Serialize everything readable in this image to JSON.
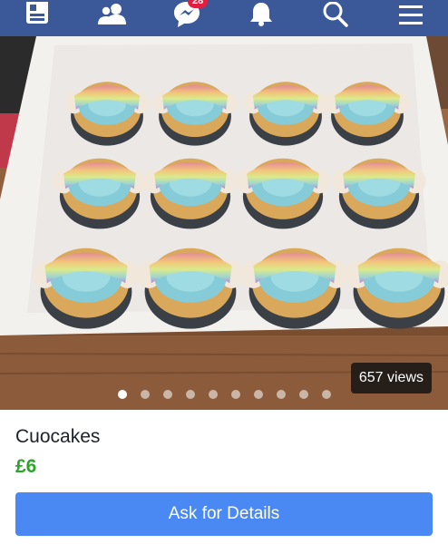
{
  "nav": {
    "items": [
      {
        "name": "feed-icon"
      },
      {
        "name": "friends-icon"
      },
      {
        "name": "messenger-icon"
      },
      {
        "name": "notifications-icon"
      },
      {
        "name": "search-icon"
      },
      {
        "name": "menu-icon"
      }
    ],
    "messenger_badge": "28",
    "colors": {
      "bar": "#3b5998",
      "badge": "#e41e3f"
    }
  },
  "listing": {
    "image_alt_subject": "box of twelve blue frosted cupcakes with rainbow sour belt candy",
    "views_label": "657 views",
    "carousel": {
      "total": 10,
      "active_index": 0
    },
    "title": "Cuocakes",
    "price": "£6",
    "cta_label": "Ask for Details",
    "colors": {
      "price": "#2aa628",
      "cta": "#4a89f3"
    }
  }
}
